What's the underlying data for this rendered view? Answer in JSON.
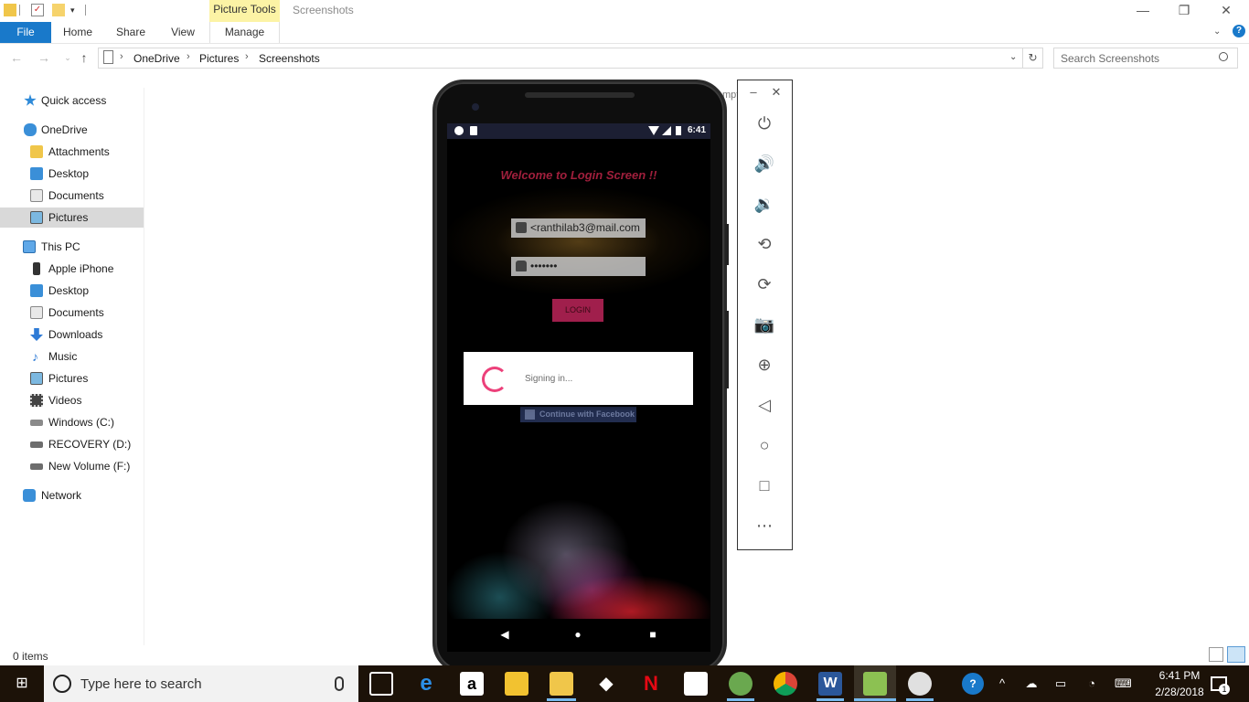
{
  "explorer": {
    "contextual_tab": "Picture Tools",
    "window_title": "Screenshots",
    "ribbon_tabs": [
      "File",
      "Home",
      "Share",
      "View",
      "Manage"
    ],
    "breadcrumb": [
      "OneDrive",
      "Pictures",
      "Screenshots"
    ],
    "search_placeholder": "Search Screenshots",
    "status": "0 items",
    "window_controls": {
      "minimize": "—",
      "maximize": "❐",
      "close": "✕"
    },
    "nav": {
      "quick_access": "Quick access",
      "onedrive": "OneDrive",
      "onedrive_items": [
        "Attachments",
        "Desktop",
        "Documents",
        "Pictures"
      ],
      "this_pc": "This PC",
      "this_pc_items": [
        "Apple iPhone",
        "Desktop",
        "Documents",
        "Downloads",
        "Music",
        "Pictures",
        "Videos",
        "Windows (C:)",
        "RECOVERY (D:)",
        "New Volume (F:)"
      ],
      "network": "Network",
      "selected": "Pictures"
    }
  },
  "emulator": {
    "status_time": "6:41",
    "app": {
      "title": "Welcome to Login Screen !!",
      "email_value": "<ranthilab3@mail.com",
      "password_value": "•••••••",
      "login_label": "LOGIN",
      "facebook_label": "Continue with Facebook"
    },
    "dialog": {
      "message": "Signing in..."
    },
    "behind_text": "mpt",
    "toolbar_icons": [
      "power-icon",
      "volume-up-icon",
      "volume-down-icon",
      "rotate-left-icon",
      "rotate-right-icon",
      "camera-icon",
      "zoom-icon",
      "back-icon",
      "home-icon",
      "overview-icon",
      "more-icon"
    ]
  },
  "taskbar": {
    "search_placeholder": "Type here to search",
    "time": "6:41 PM",
    "date": "2/28/2018",
    "notification_count": "1"
  },
  "colors": {
    "file_tab": "#1979ca",
    "contextual_tab": "#fcf3a5",
    "app_title": "#a01f3c",
    "spinner": "#ec407a",
    "taskbar": "#1c1208"
  }
}
